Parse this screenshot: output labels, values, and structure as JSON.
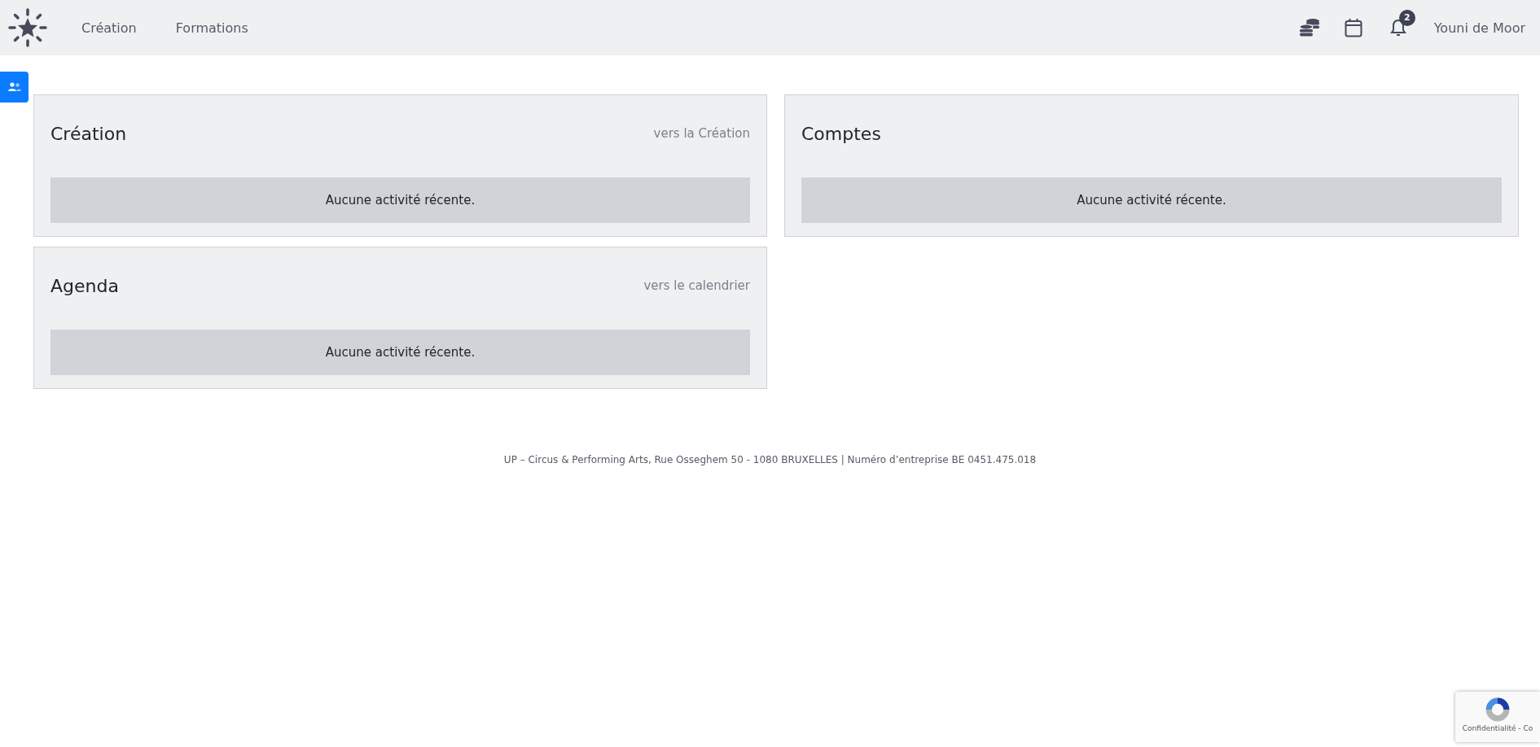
{
  "navbar": {
    "links": [
      {
        "label": "Création"
      },
      {
        "label": "Formations"
      }
    ],
    "notifications": {
      "badge": "2"
    },
    "user": "Youni de Moor"
  },
  "cards": [
    {
      "title": "Création",
      "link": "vers la Création",
      "message": "Aucune activité récente."
    },
    {
      "title": "Comptes",
      "message": "Aucune activité récente."
    },
    {
      "title": "Agenda",
      "link": "vers le calendrier",
      "message": "Aucune activité récente."
    }
  ],
  "footer": "UP – Circus & Performing Arts, Rue Osseghem 50 - 1080 BRUXELLES | Numéro d’entreprise BE 0451.475.018",
  "recaptcha": {
    "text": "Confidentialité - Co"
  }
}
